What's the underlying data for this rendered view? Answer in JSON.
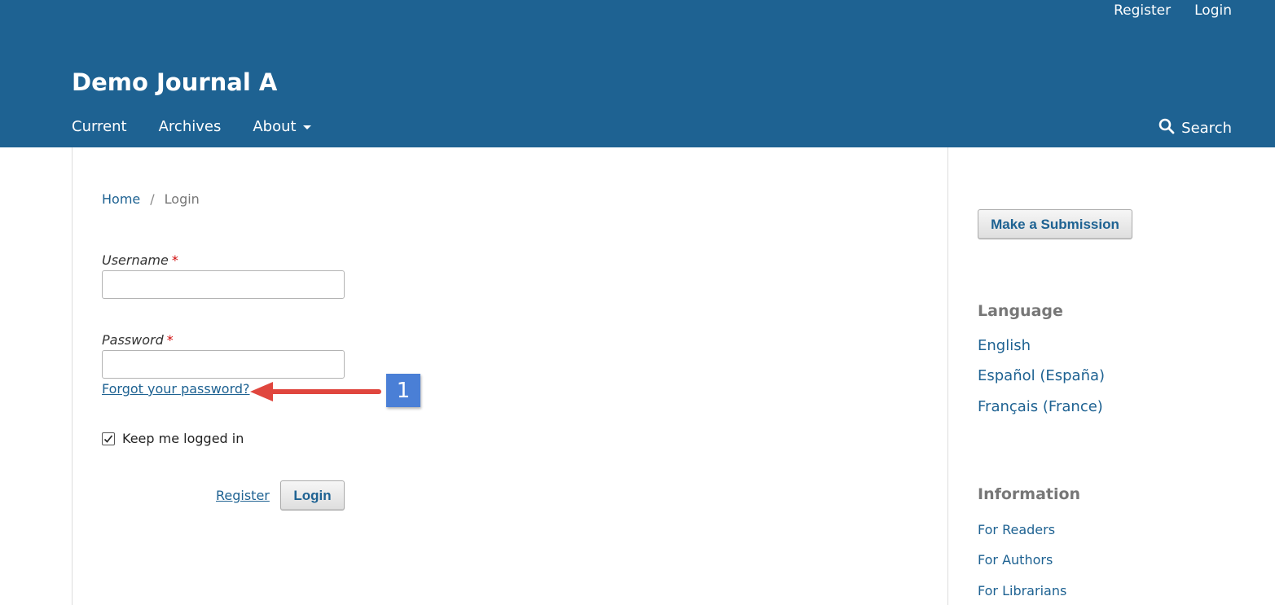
{
  "header": {
    "user_nav": {
      "register": "Register",
      "login": "Login"
    },
    "site_title": "Demo Journal A",
    "nav": {
      "current": "Current",
      "archives": "Archives",
      "about": "About"
    },
    "search_label": "Search"
  },
  "breadcrumb": {
    "home": "Home",
    "separator": "/",
    "current": "Login"
  },
  "form": {
    "username_label": "Username",
    "password_label": "Password",
    "required_mark": "*",
    "forgot_password": "Forgot your password?",
    "keep_logged_in": "Keep me logged in",
    "keep_logged_in_checked": true,
    "register_link": "Register",
    "login_button": "Login"
  },
  "annotation": {
    "badge_number": "1",
    "arrow_color": "#e0463e",
    "badge_color": "#4a7fd6"
  },
  "sidebar": {
    "submission_button": "Make a Submission",
    "language_heading": "Language",
    "languages": [
      "English",
      "Español (España)",
      "Français (France)"
    ],
    "information_heading": "Information",
    "info_links": [
      "For Readers",
      "For Authors",
      "For Librarians"
    ]
  },
  "colors": {
    "header_bg": "#1e6292",
    "link": "#1e6292",
    "required": "#d00a0a"
  }
}
